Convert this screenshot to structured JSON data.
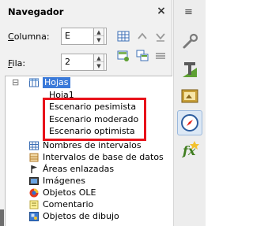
{
  "navigator": {
    "title": "Navegador",
    "close_label": "×",
    "column_label_first": "C",
    "column_label_rest": "olumna:",
    "column_value": "E",
    "row_label_first": "F",
    "row_label_rest": "ila:",
    "row_value": "2"
  },
  "tree": {
    "expander": "⊟",
    "root": "Hojas",
    "sheets": [
      "Hoja1",
      "Escenario pesimista",
      "Escenario moderado",
      "Escenario optimista"
    ],
    "categories": [
      "Nombres de intervalos",
      "Intervalos de base de datos",
      "Áreas enlazadas",
      "Imágenes",
      "Objetos OLE",
      "Comentario",
      "Objetos de dibujo"
    ]
  },
  "sidebar": {
    "menu_icon": "≡",
    "icons": [
      "properties-icon",
      "styles-icon",
      "gallery-icon",
      "navigator-icon",
      "functions-icon"
    ]
  },
  "colors": {
    "selection": "#3b7ad9",
    "highlight_box": "#e8121a"
  }
}
